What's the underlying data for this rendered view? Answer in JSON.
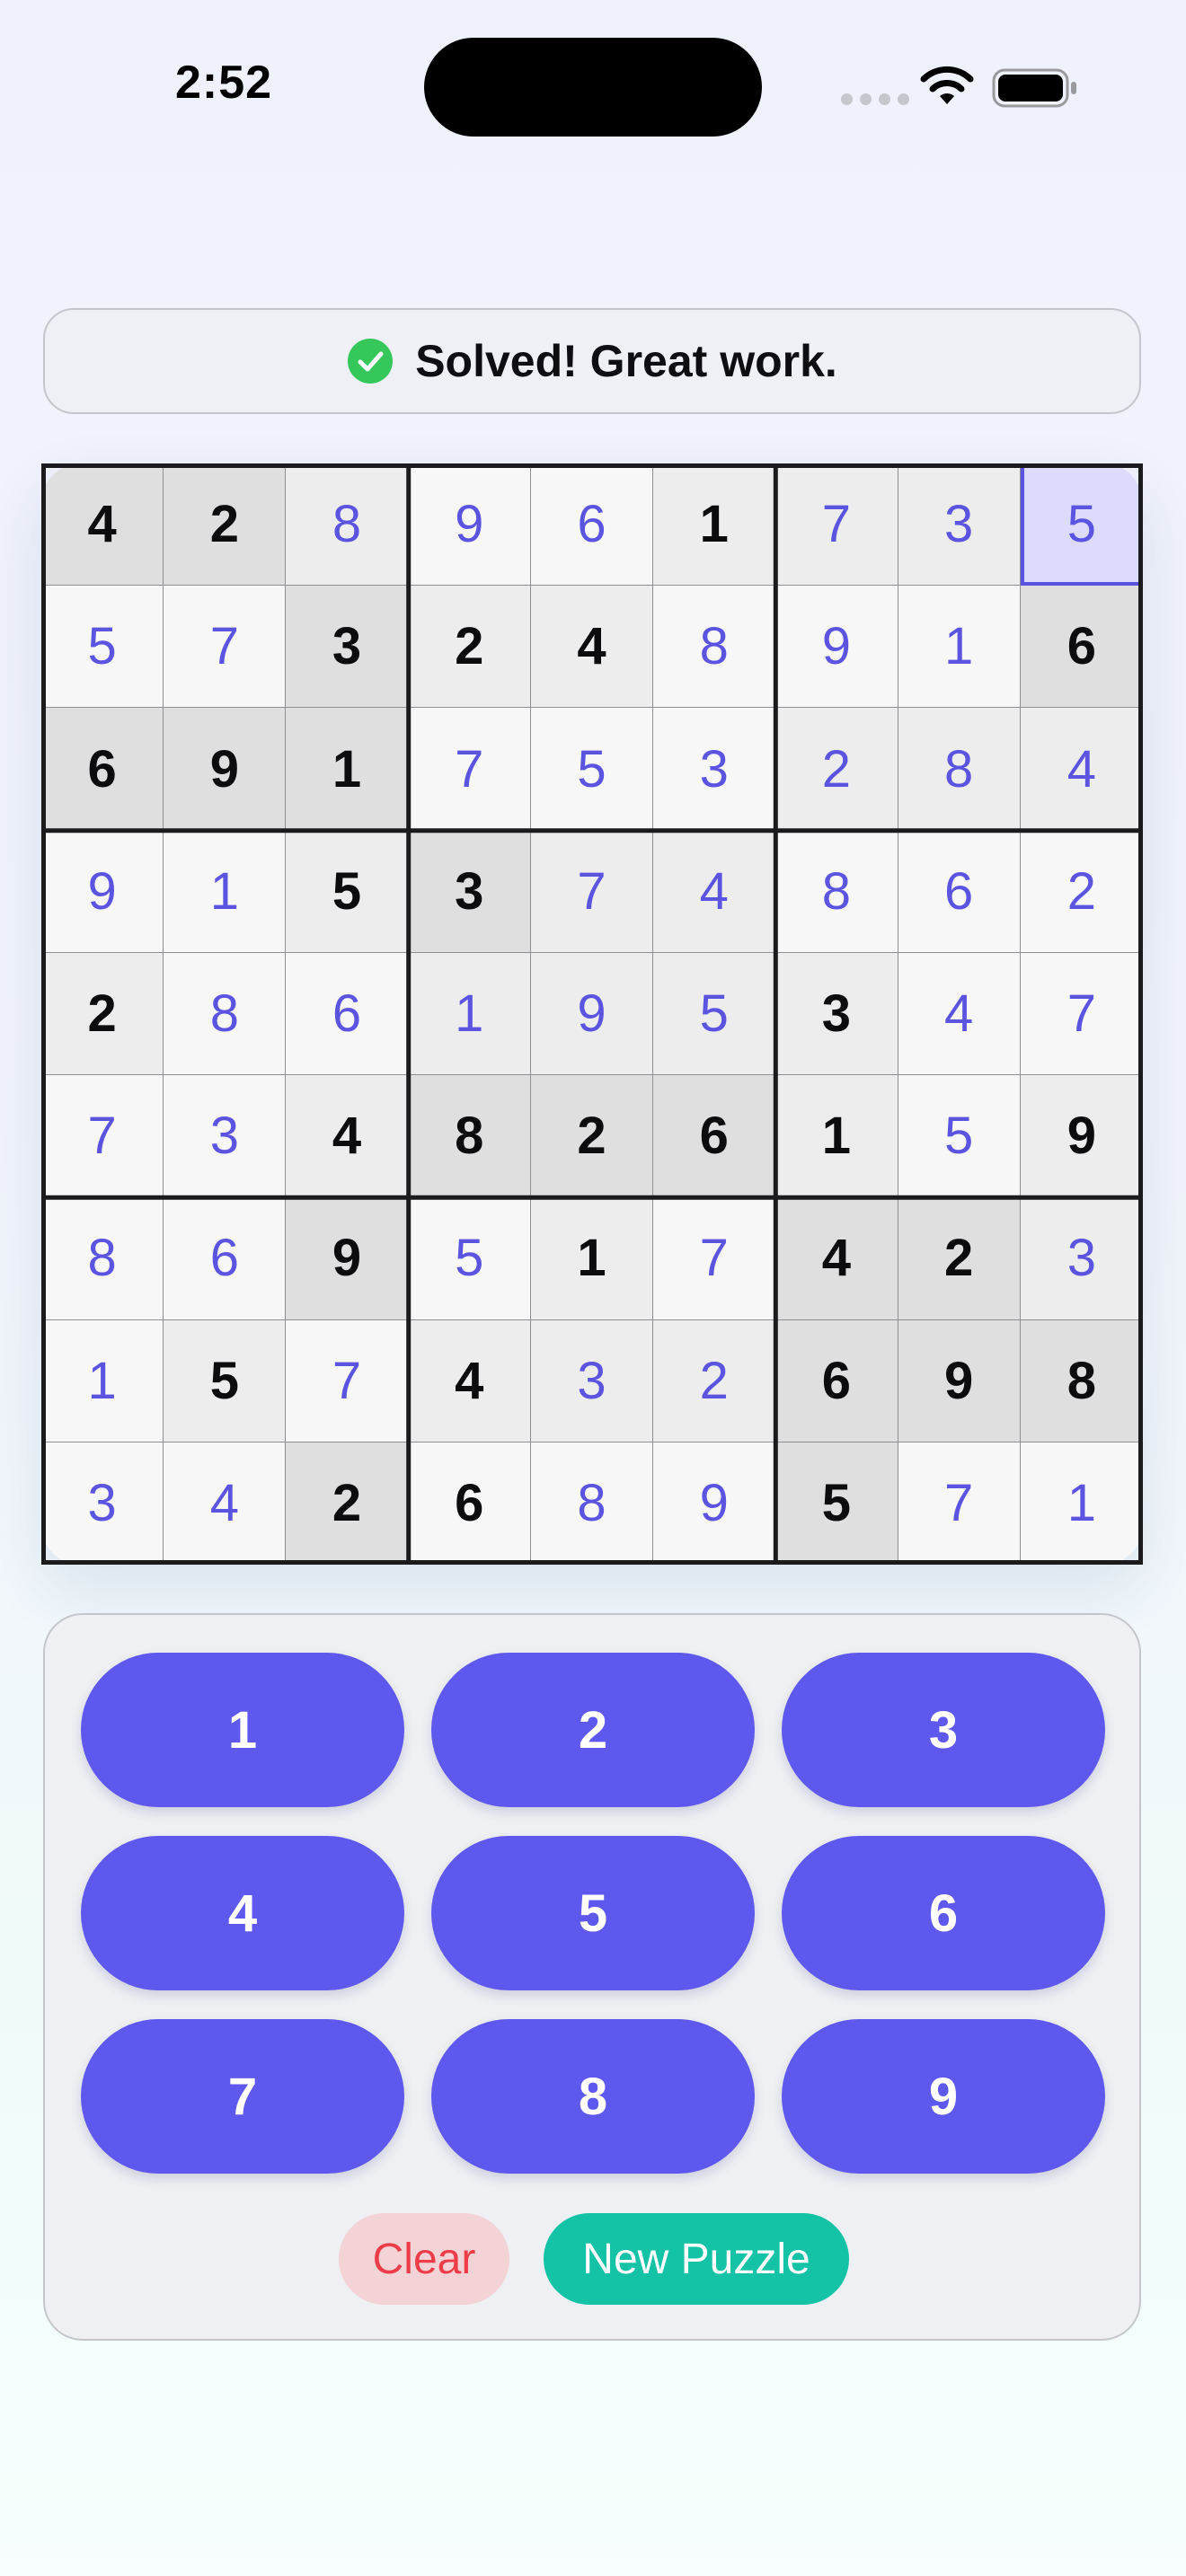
{
  "status_bar": {
    "time": "2:52",
    "icons": [
      "signal-dots-icon",
      "wifi-icon",
      "battery-icon"
    ]
  },
  "banner": {
    "icon": "check-circle-icon",
    "text": "Solved! Great work."
  },
  "board": {
    "selected_cell": [
      0,
      8
    ],
    "cells": [
      [
        {
          "v": "4",
          "t": "g",
          "s": "d"
        },
        {
          "v": "2",
          "t": "g",
          "s": "d"
        },
        {
          "v": "8",
          "t": "e",
          "s": "l"
        },
        {
          "v": "9",
          "t": "e",
          "s": "w"
        },
        {
          "v": "6",
          "t": "e",
          "s": "w"
        },
        {
          "v": "1",
          "t": "g",
          "s": "l"
        },
        {
          "v": "7",
          "t": "e",
          "s": "l"
        },
        {
          "v": "3",
          "t": "e",
          "s": "l"
        },
        {
          "v": "5",
          "t": "e",
          "s": "l"
        }
      ],
      [
        {
          "v": "5",
          "t": "e",
          "s": "w"
        },
        {
          "v": "7",
          "t": "e",
          "s": "w"
        },
        {
          "v": "3",
          "t": "g",
          "s": "d"
        },
        {
          "v": "2",
          "t": "g",
          "s": "l"
        },
        {
          "v": "4",
          "t": "g",
          "s": "l"
        },
        {
          "v": "8",
          "t": "e",
          "s": "w"
        },
        {
          "v": "9",
          "t": "e",
          "s": "w"
        },
        {
          "v": "1",
          "t": "e",
          "s": "w"
        },
        {
          "v": "6",
          "t": "g",
          "s": "d"
        }
      ],
      [
        {
          "v": "6",
          "t": "g",
          "s": "d"
        },
        {
          "v": "9",
          "t": "g",
          "s": "d"
        },
        {
          "v": "1",
          "t": "g",
          "s": "d"
        },
        {
          "v": "7",
          "t": "e",
          "s": "w"
        },
        {
          "v": "5",
          "t": "e",
          "s": "w"
        },
        {
          "v": "3",
          "t": "e",
          "s": "w"
        },
        {
          "v": "2",
          "t": "e",
          "s": "l"
        },
        {
          "v": "8",
          "t": "e",
          "s": "l"
        },
        {
          "v": "4",
          "t": "e",
          "s": "l"
        }
      ],
      [
        {
          "v": "9",
          "t": "e",
          "s": "w"
        },
        {
          "v": "1",
          "t": "e",
          "s": "w"
        },
        {
          "v": "5",
          "t": "g",
          "s": "l"
        },
        {
          "v": "3",
          "t": "g",
          "s": "d"
        },
        {
          "v": "7",
          "t": "e",
          "s": "l"
        },
        {
          "v": "4",
          "t": "e",
          "s": "l"
        },
        {
          "v": "8",
          "t": "e",
          "s": "w"
        },
        {
          "v": "6",
          "t": "e",
          "s": "w"
        },
        {
          "v": "2",
          "t": "e",
          "s": "w"
        }
      ],
      [
        {
          "v": "2",
          "t": "g",
          "s": "l"
        },
        {
          "v": "8",
          "t": "e",
          "s": "w"
        },
        {
          "v": "6",
          "t": "e",
          "s": "w"
        },
        {
          "v": "1",
          "t": "e",
          "s": "l"
        },
        {
          "v": "9",
          "t": "e",
          "s": "l"
        },
        {
          "v": "5",
          "t": "e",
          "s": "l"
        },
        {
          "v": "3",
          "t": "g",
          "s": "l"
        },
        {
          "v": "4",
          "t": "e",
          "s": "w"
        },
        {
          "v": "7",
          "t": "e",
          "s": "w"
        }
      ],
      [
        {
          "v": "7",
          "t": "e",
          "s": "w"
        },
        {
          "v": "3",
          "t": "e",
          "s": "w"
        },
        {
          "v": "4",
          "t": "g",
          "s": "l"
        },
        {
          "v": "8",
          "t": "g",
          "s": "d"
        },
        {
          "v": "2",
          "t": "g",
          "s": "d"
        },
        {
          "v": "6",
          "t": "g",
          "s": "d"
        },
        {
          "v": "1",
          "t": "g",
          "s": "l"
        },
        {
          "v": "5",
          "t": "e",
          "s": "w"
        },
        {
          "v": "9",
          "t": "g",
          "s": "l"
        }
      ],
      [
        {
          "v": "8",
          "t": "e",
          "s": "w"
        },
        {
          "v": "6",
          "t": "e",
          "s": "w"
        },
        {
          "v": "9",
          "t": "g",
          "s": "d"
        },
        {
          "v": "5",
          "t": "e",
          "s": "w"
        },
        {
          "v": "1",
          "t": "g",
          "s": "l"
        },
        {
          "v": "7",
          "t": "e",
          "s": "w"
        },
        {
          "v": "4",
          "t": "g",
          "s": "d"
        },
        {
          "v": "2",
          "t": "g",
          "s": "d"
        },
        {
          "v": "3",
          "t": "e",
          "s": "l"
        }
      ],
      [
        {
          "v": "1",
          "t": "e",
          "s": "w"
        },
        {
          "v": "5",
          "t": "g",
          "s": "l"
        },
        {
          "v": "7",
          "t": "e",
          "s": "w"
        },
        {
          "v": "4",
          "t": "g",
          "s": "l"
        },
        {
          "v": "3",
          "t": "e",
          "s": "l"
        },
        {
          "v": "2",
          "t": "e",
          "s": "l"
        },
        {
          "v": "6",
          "t": "g",
          "s": "d"
        },
        {
          "v": "9",
          "t": "g",
          "s": "d"
        },
        {
          "v": "8",
          "t": "g",
          "s": "d"
        }
      ],
      [
        {
          "v": "3",
          "t": "e",
          "s": "w"
        },
        {
          "v": "4",
          "t": "e",
          "s": "w"
        },
        {
          "v": "2",
          "t": "g",
          "s": "d"
        },
        {
          "v": "6",
          "t": "g",
          "s": "w"
        },
        {
          "v": "8",
          "t": "e",
          "s": "w"
        },
        {
          "v": "9",
          "t": "e",
          "s": "w"
        },
        {
          "v": "5",
          "t": "g",
          "s": "d"
        },
        {
          "v": "7",
          "t": "e",
          "s": "w"
        },
        {
          "v": "1",
          "t": "e",
          "s": "w"
        }
      ]
    ]
  },
  "keypad": {
    "keys": [
      "1",
      "2",
      "3",
      "4",
      "5",
      "6",
      "7",
      "8",
      "9"
    ],
    "clear_label": "Clear",
    "new_puzzle_label": "New Puzzle"
  },
  "colors": {
    "accent": "#5e58ee",
    "entered_digit": "#5b54e0",
    "success": "#35c759",
    "clear_text": "#ee3d49",
    "clear_bg": "#f3d3d5",
    "new_puzzle_bg": "#14c3a6",
    "shade_white": "#f7f7f7",
    "shade_light": "#ededed",
    "shade_dark": "#dfdfdf"
  }
}
